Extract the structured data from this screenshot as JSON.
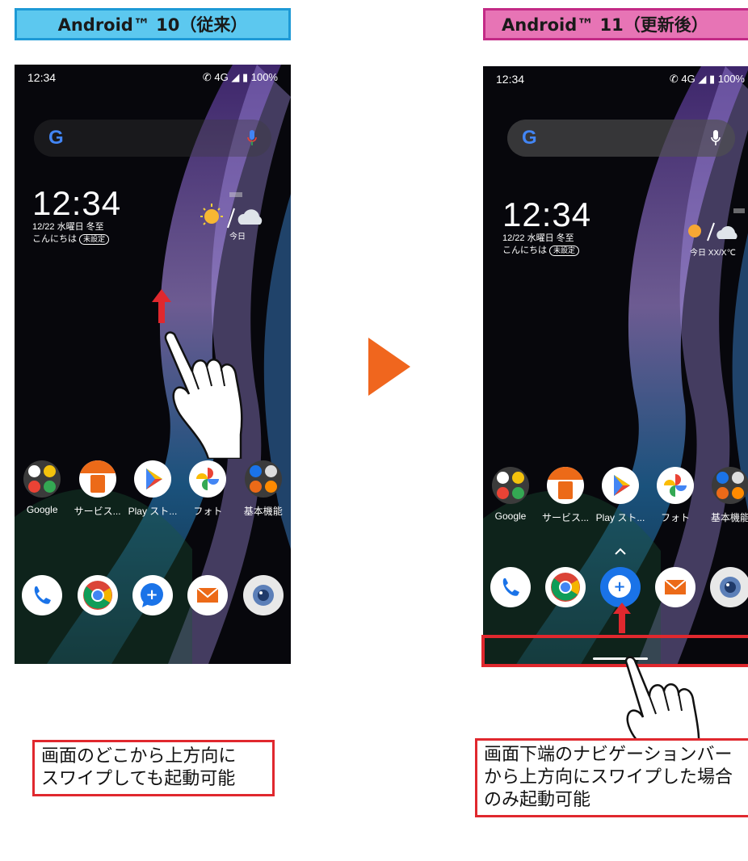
{
  "headers": {
    "left": "Android™ 10（従来）",
    "right": "Android™ 11（更新後）"
  },
  "colors": {
    "left_header_bg": "#5cc8ef",
    "right_header_bg": "#e774b5",
    "highlight_red": "#e0282e",
    "transition_arrow": "#f0661e"
  },
  "phone_left": {
    "status_time": "12:34",
    "status_icons": "✆ 4G ◢ ▮ 100%",
    "clock": "12:34",
    "date": "12/22 水曜日 冬至",
    "greeting": "こんにちは",
    "badge": "未設定",
    "weather_label": "今日",
    "apps": [
      "Google",
      "サービス...",
      "Play スト...",
      "フォト",
      "基本機能"
    ]
  },
  "phone_right": {
    "status_time": "12:34",
    "status_icons": "✆ 4G ◢ ▮ 100%",
    "clock": "12:34",
    "date": "12/22 水曜日 冬至",
    "greeting": "こんにちは",
    "badge": "未設定",
    "weather_label": "今日 XX/X℃",
    "apps": [
      "Google",
      "サービス...",
      "Play スト...",
      "フォト",
      "基本機能"
    ]
  },
  "captions": {
    "left": [
      "画面のどこから上方向に",
      "スワイプしても起動可能"
    ],
    "right": [
      "画面下端のナビゲーションバー",
      "から上方向にスワイプした場合",
      "のみ起動可能"
    ]
  },
  "icons": [
    "google-folder-icon",
    "au-service-icon",
    "play-store-icon",
    "photos-icon",
    "basic-functions-folder-icon",
    "phone-icon",
    "chrome-icon",
    "messages-icon",
    "au-mail-icon",
    "camera-icon",
    "hand-swipe-icon",
    "up-arrow-icon",
    "next-arrow-icon"
  ]
}
